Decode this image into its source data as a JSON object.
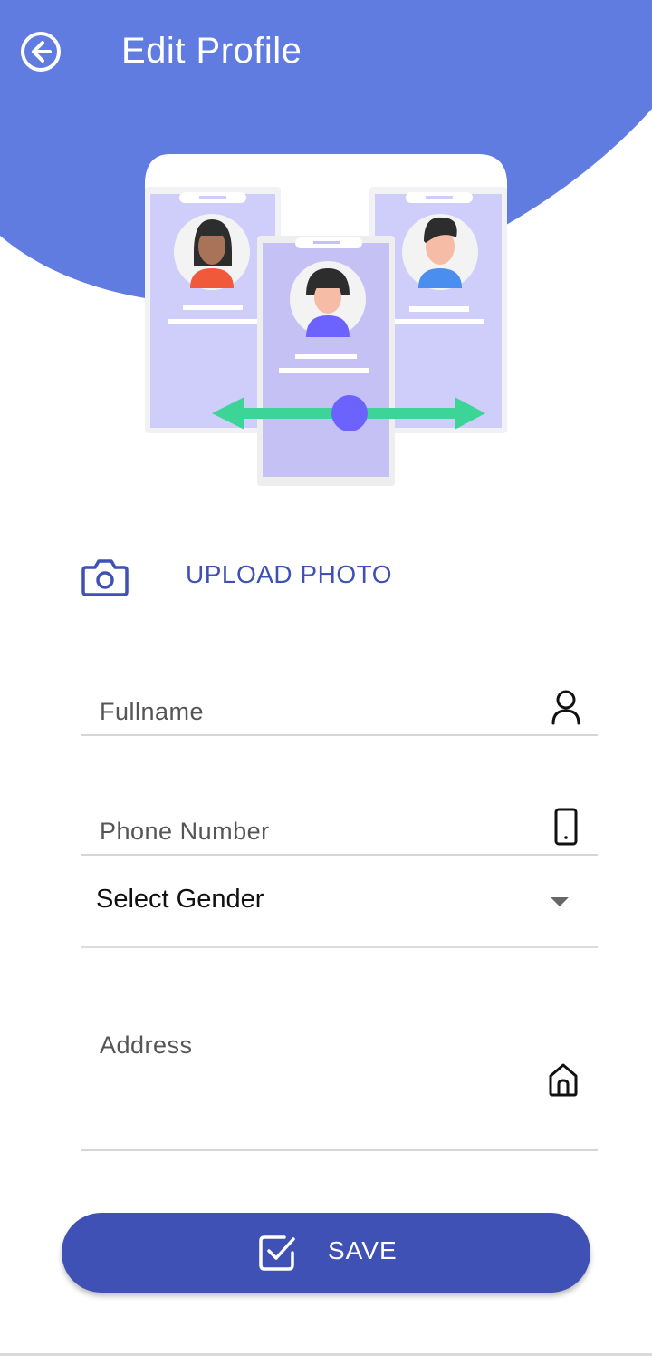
{
  "header": {
    "title": "Edit Profile",
    "back_icon": "arrow-left-circle-icon",
    "background_color": "#617ce0"
  },
  "illustration": {
    "name": "profile-cards-illustration",
    "card_color": "#cfcdfa",
    "arrow_color": "#3dd597",
    "accent_color": "#6c63ff"
  },
  "upload": {
    "icon": "camera-icon",
    "label": "UPLOAD PHOTO"
  },
  "form": {
    "fullname": {
      "placeholder": "Fullname",
      "icon": "person-icon"
    },
    "phone": {
      "placeholder": "Phone Number",
      "icon": "phone-icon"
    },
    "gender": {
      "selected": "Select Gender",
      "icon": "dropdown-arrow-icon"
    },
    "address": {
      "placeholder": "Address",
      "icon": "home-icon"
    }
  },
  "save_button": {
    "label": "SAVE",
    "icon": "checkbox-icon",
    "color": "#3f51b5"
  }
}
